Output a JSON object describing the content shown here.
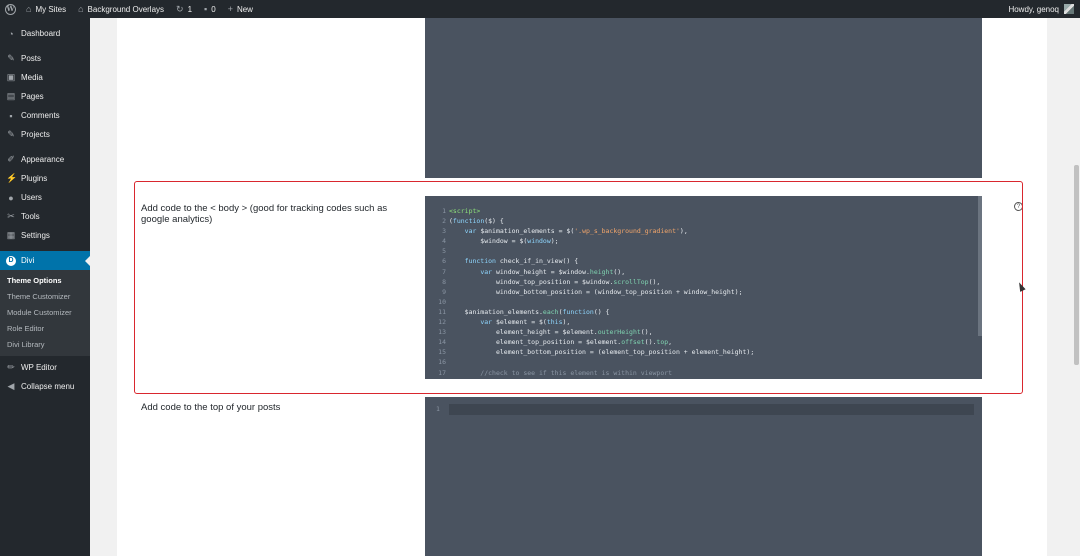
{
  "adminbar": {
    "my_sites": "My Sites",
    "site_name": "Background Overlays",
    "updates_count": "1",
    "comments_count": "0",
    "new_label": "New",
    "howdy": "Howdy, genoq"
  },
  "sidebar": {
    "items": [
      {
        "label": "Dashboard",
        "icon": "gauge-icon"
      },
      {
        "label": "Posts",
        "icon": "pin-icon"
      },
      {
        "label": "Media",
        "icon": "media-icon"
      },
      {
        "label": "Pages",
        "icon": "pages-icon"
      },
      {
        "label": "Comments",
        "icon": "comment-icon"
      },
      {
        "label": "Projects",
        "icon": "pin-icon"
      },
      {
        "label": "Appearance",
        "icon": "brush-icon"
      },
      {
        "label": "Plugins",
        "icon": "plug-icon"
      },
      {
        "label": "Users",
        "icon": "user-icon"
      },
      {
        "label": "Tools",
        "icon": "wrench-icon"
      },
      {
        "label": "Settings",
        "icon": "settings-icon"
      }
    ],
    "divi_label": "Divi",
    "submenu": [
      "Theme Options",
      "Theme Customizer",
      "Module Customizer",
      "Role Editor",
      "Divi Library"
    ],
    "wp_editor": "WP Editor",
    "collapse": "Collapse menu"
  },
  "main": {
    "body_code_label": "Add code to the < body > (good for tracking codes such as google analytics)",
    "top_posts_label": "Add code to the top of your posts",
    "help_icon": "?",
    "code_lines": [
      {
        "n": "1",
        "text": "<script>"
      },
      {
        "n": "2",
        "text": "(function($) {"
      },
      {
        "n": "3",
        "text": "    var $animation_elements = $('.wp_s_background_gradient'),"
      },
      {
        "n": "4",
        "text": "        $window = $(window);"
      },
      {
        "n": "5",
        "text": ""
      },
      {
        "n": "6",
        "text": "    function check_if_in_view() {"
      },
      {
        "n": "7",
        "text": "        var window_height = $window.height(),"
      },
      {
        "n": "8",
        "text": "            window_top_position = $window.scrollTop(),"
      },
      {
        "n": "9",
        "text": "            window_bottom_position = (window_top_position + window_height);"
      },
      {
        "n": "10",
        "text": ""
      },
      {
        "n": "11",
        "text": "    $animation_elements.each(function() {"
      },
      {
        "n": "12",
        "text": "        var $element = $(this),"
      },
      {
        "n": "13",
        "text": "            element_height = $element.outerHeight(),"
      },
      {
        "n": "14",
        "text": "            element_top_position = $element.offset().top,"
      },
      {
        "n": "15",
        "text": "            element_bottom_position = (element_top_position + element_height);"
      },
      {
        "n": "16",
        "text": ""
      },
      {
        "n": "17",
        "text": "        //check to see if this element is within viewport"
      }
    ],
    "empty_editor_line": "1"
  }
}
